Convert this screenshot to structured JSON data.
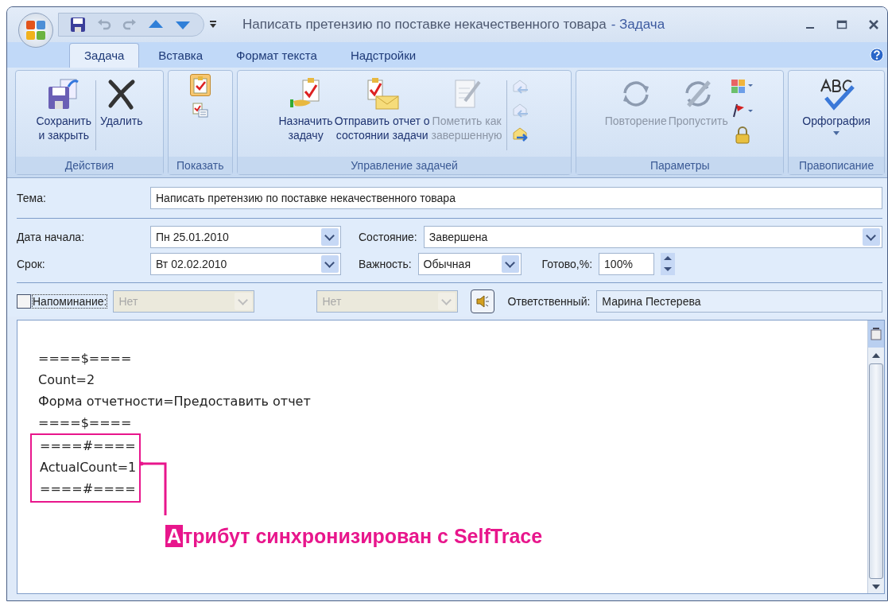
{
  "window": {
    "title": "Написать претензию по поставке некачественного товара",
    "app_name": "- Задача"
  },
  "tabs": [
    {
      "label": "Задача",
      "selected": true
    },
    {
      "label": "Вставка",
      "selected": false
    },
    {
      "label": "Формат текста",
      "selected": false
    },
    {
      "label": "Надстройки",
      "selected": false
    }
  ],
  "ribbon": {
    "groups": [
      {
        "label": "Действия",
        "buttons": [
          {
            "label": "Сохранить\nи закрыть",
            "disabled": false
          },
          {
            "label": "Удалить",
            "disabled": false
          }
        ]
      },
      {
        "label": "Показать",
        "buttons": [
          {
            "selected": true
          },
          {
            "selected": false
          }
        ]
      },
      {
        "label": "Управление задачей",
        "buttons": [
          {
            "label": "Назначить\nзадачу",
            "disabled": false
          },
          {
            "label": "Отправить отчет о\nсостоянии задачи",
            "disabled": false
          },
          {
            "label": "Пометить как\nзавершенную",
            "disabled": true
          },
          {
            "disabled": true
          },
          {
            "disabled": true
          },
          {
            "disabled": false
          }
        ]
      },
      {
        "label": "Параметры",
        "buttons": [
          {
            "label": "Повторение",
            "disabled": true
          },
          {
            "label": "Пропустить",
            "disabled": true
          }
        ]
      },
      {
        "label": "Правописание",
        "buttons": [
          {
            "label": "Орфография",
            "disabled": false
          }
        ]
      }
    ]
  },
  "form": {
    "subject": {
      "label": "Тема:",
      "value": "Написать претензию по поставке некачественного товара"
    },
    "start_date": {
      "label": "Дата начала:",
      "value": "Пн 25.01.2010"
    },
    "due_date": {
      "label": "Срок:",
      "value": "Вт 02.02.2010"
    },
    "status": {
      "label": "Состояние:",
      "value": "Завершена"
    },
    "priority": {
      "label": "Важность:",
      "value": "Обычная"
    },
    "percent": {
      "label": "Готово,%:",
      "value": "100%"
    },
    "reminder": {
      "label": "Напоминание:",
      "checked": false,
      "date": "Нет",
      "time": "Нет",
      "disabled": true
    },
    "owner": {
      "label": "Ответственный:",
      "value": "Марина Пестерева"
    }
  },
  "body": {
    "lines": [
      "====$====",
      "Count=2",
      "Форма отчетности=Предоставить отчет",
      "====$===="
    ],
    "highlighted_lines": [
      "====#====",
      "ActualCount=1",
      "====#===="
    ],
    "annotation": {
      "marker": "А",
      "text": "трибут синхронизирован с SelfTrace"
    }
  }
}
